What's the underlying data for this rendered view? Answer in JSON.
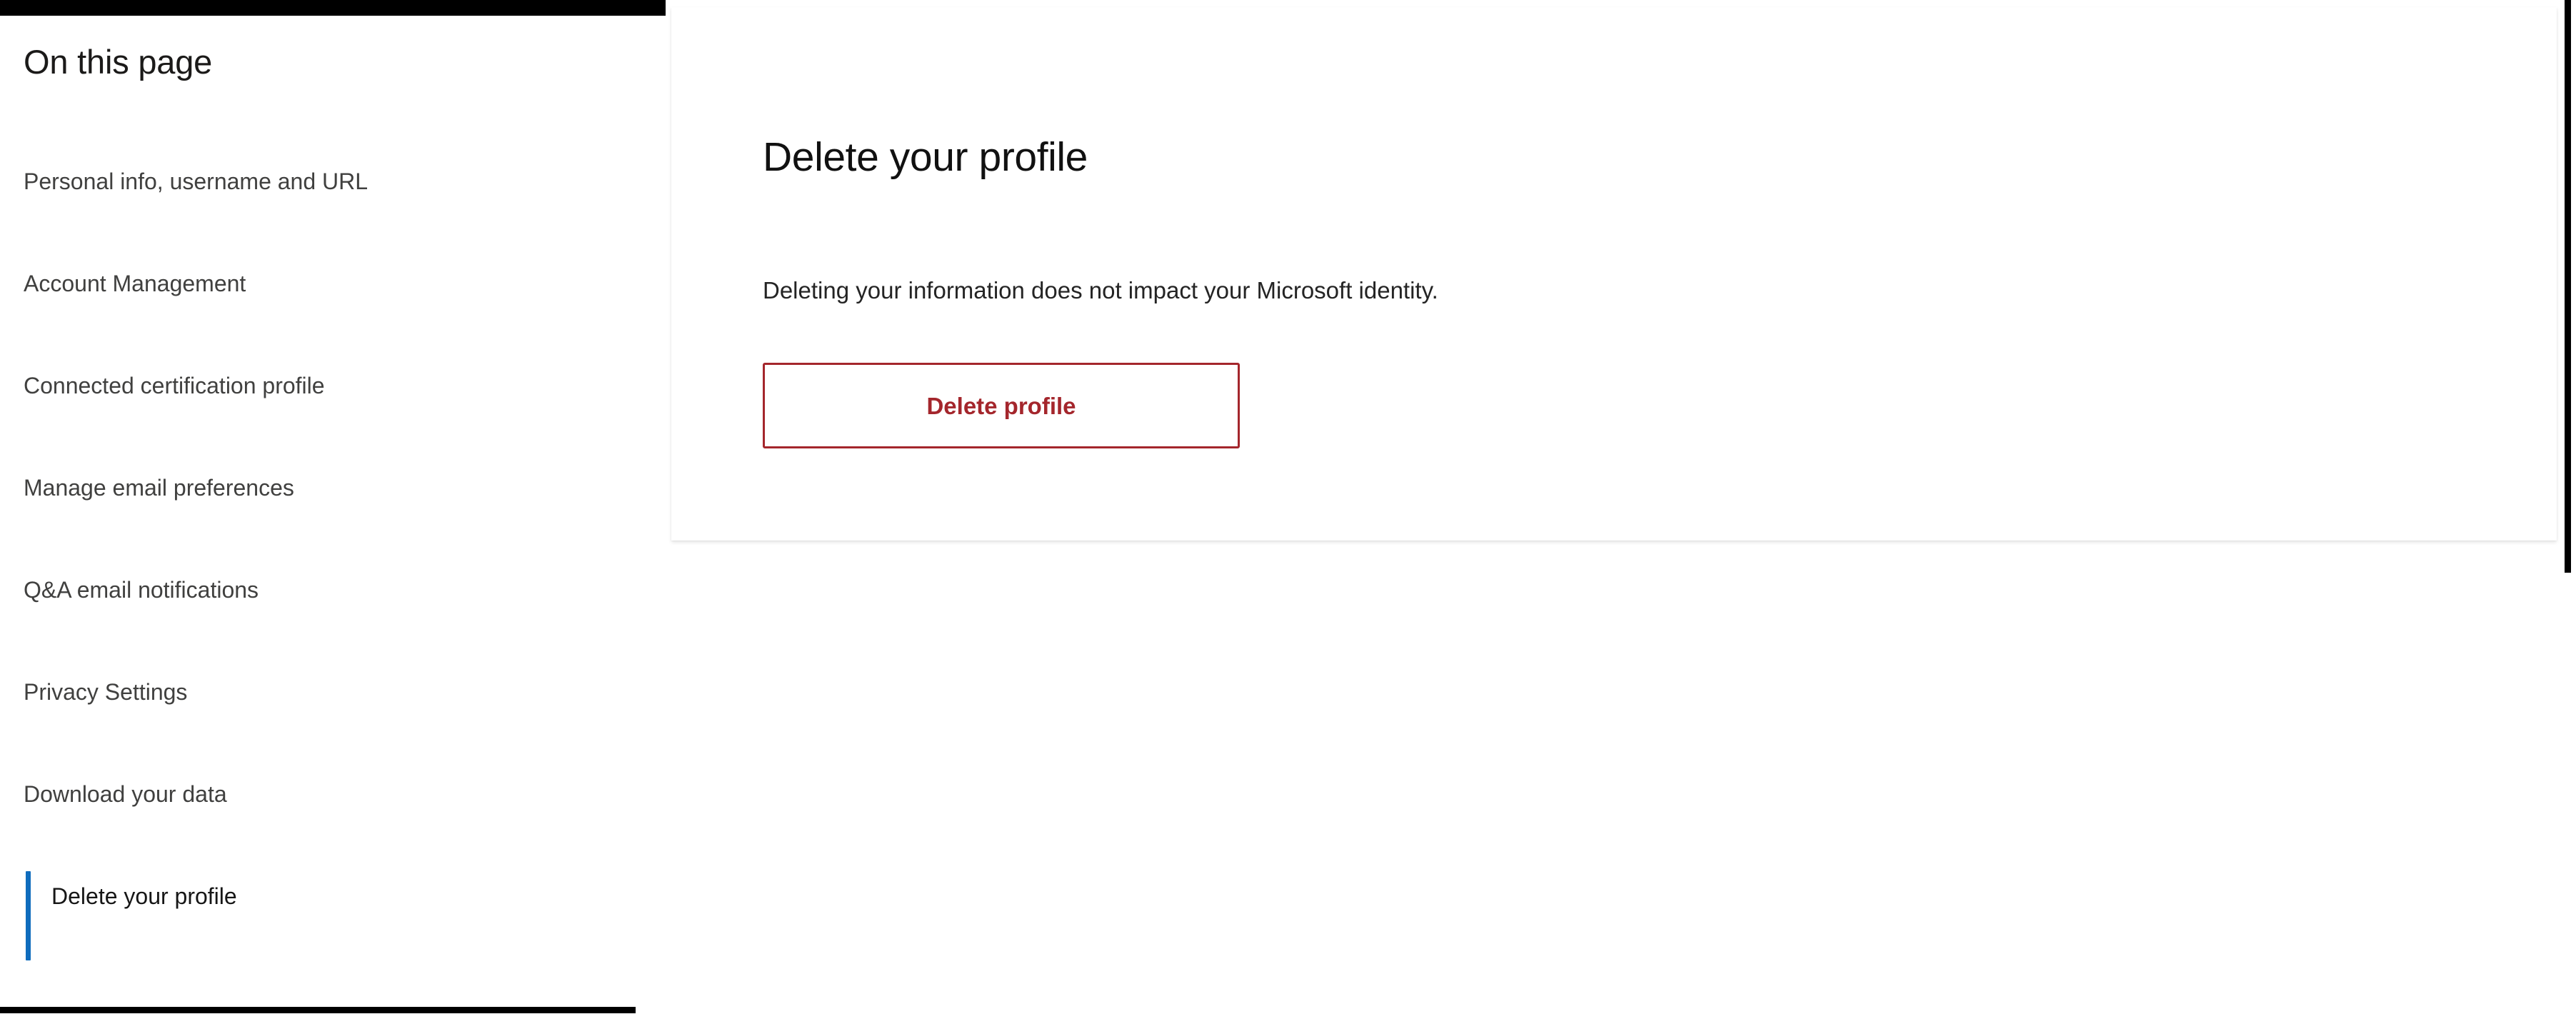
{
  "sidebar": {
    "title": "On this page",
    "items": [
      {
        "label": "Personal info, username and URL",
        "active": false
      },
      {
        "label": "Account Management",
        "active": false
      },
      {
        "label": "Connected certification profile",
        "active": false
      },
      {
        "label": "Manage email preferences",
        "active": false
      },
      {
        "label": "Q&A email notifications",
        "active": false
      },
      {
        "label": "Privacy Settings",
        "active": false
      },
      {
        "label": "Download your data",
        "active": false
      },
      {
        "label": "Delete your profile",
        "active": true
      }
    ],
    "active_indicator_color": "#0F6CBD"
  },
  "main": {
    "heading": "Delete your profile",
    "description": "Deleting your information does not impact your Microsoft identity.",
    "delete_button_label": "Delete profile",
    "delete_button_color": "#A4262C"
  }
}
